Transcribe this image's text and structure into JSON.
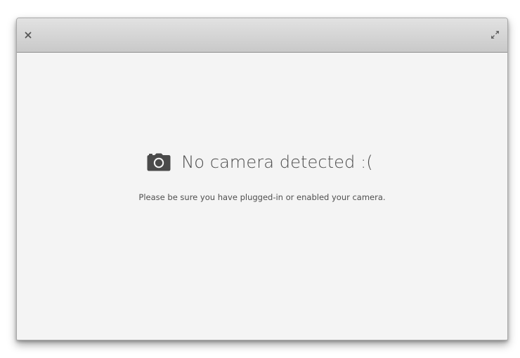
{
  "window": {
    "close_icon": "close-icon",
    "maximize_icon": "maximize-icon"
  },
  "message": {
    "icon": "camera-icon",
    "title": "No camera detected :(",
    "subtitle": "Please be sure you have plugged-in or enabled your camera."
  },
  "colors": {
    "titlebar_top": "#e2e2e2",
    "titlebar_bottom": "#c9c9c9",
    "background": "#f4f4f4",
    "text": "#4a4a4a"
  }
}
